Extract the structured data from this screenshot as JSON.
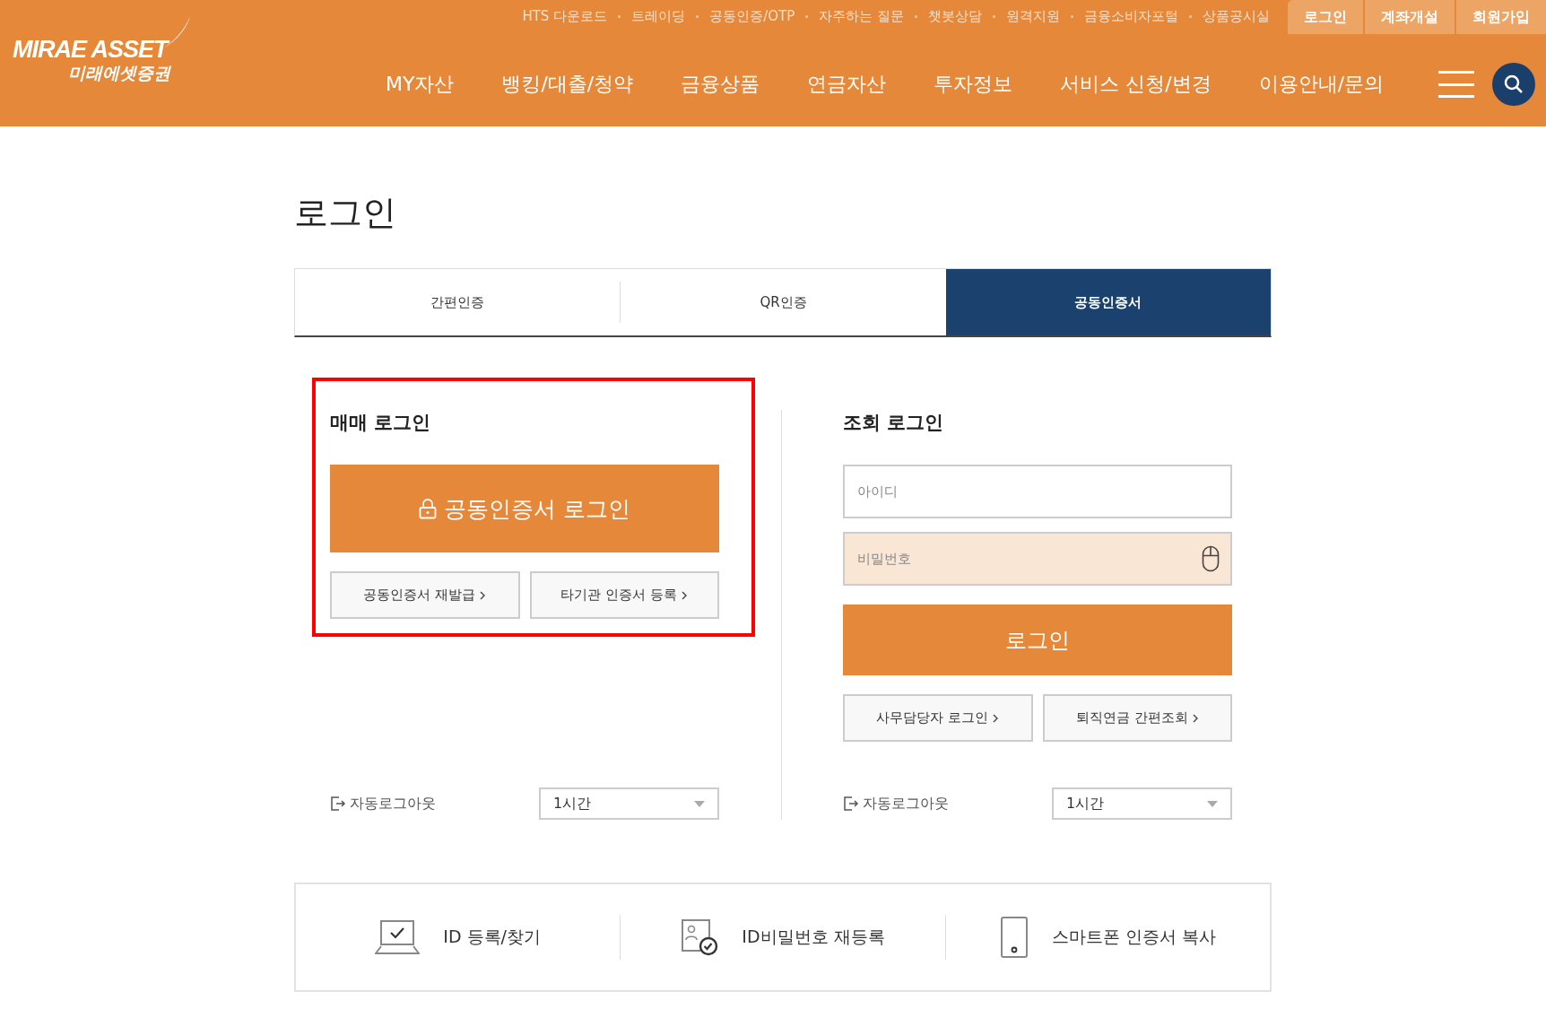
{
  "header": {
    "logo": {
      "brand": "MIRAE ASSET",
      "name": "미래에셋증권"
    },
    "utility_links": [
      "HTS 다운로드",
      "트레이딩",
      "공동인증/OTP",
      "자주하는 질문",
      "챗봇상담",
      "원격지원",
      "금융소비자포털",
      "상품공시실"
    ],
    "account_links": [
      "로그인",
      "계좌개설",
      "회원가입"
    ],
    "nav": [
      "MY자산",
      "뱅킹/대출/청약",
      "금융상품",
      "연금자산",
      "투자정보",
      "서비스 신청/변경",
      "이용안내/문의"
    ]
  },
  "page_title": "로그인",
  "tabs": [
    {
      "label": "간편인증",
      "selected": false
    },
    {
      "label": "QR인증",
      "selected": false
    },
    {
      "label": "공동인증서",
      "selected": true
    }
  ],
  "trade_login": {
    "title": "매매 로그인",
    "highlighted": true,
    "main_button": "공동인증서 로그인",
    "links": [
      "공동인증서 재발급",
      "타기관 인증서 등록"
    ],
    "auto_logout": {
      "label": "자동로그아웃",
      "value": "1시간"
    }
  },
  "inquiry_login": {
    "title": "조회 로그인",
    "id_field": {
      "placeholder": "아이디"
    },
    "password_field": {
      "placeholder": "비밀번호"
    },
    "login_button": "로그인",
    "links": [
      "사무담당자 로그인",
      "퇴직연금 간편조회"
    ],
    "auto_logout": {
      "label": "자동로그아웃",
      "value": "1시간"
    }
  },
  "bottom_links": [
    {
      "kind": "laptop",
      "label": "ID 등록/찾기"
    },
    {
      "kind": "id-card",
      "label": "ID비밀번호 재등록"
    },
    {
      "kind": "phone",
      "label": "스마트폰 인증서 복사"
    }
  ]
}
